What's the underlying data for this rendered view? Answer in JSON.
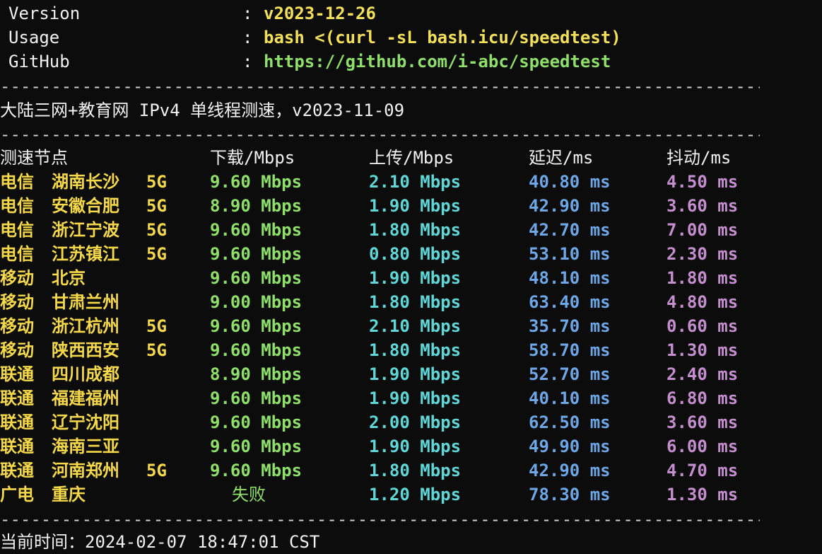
{
  "info": [
    {
      "key": "Version",
      "value": "v2023-12-26",
      "color": "yellow"
    },
    {
      "key": "Usage",
      "value": "bash <(curl -sL bash.icu/speedtest)",
      "color": "yellow"
    },
    {
      "key": "GitHub",
      "value": "https://github.com/i-abc/speedtest",
      "color": "green"
    }
  ],
  "separator": "----------------------------------------------------------------------------------------------------",
  "test_title": "大陆三网+教育网 IPv4 单线程测速，v2023-11-09",
  "headers": {
    "node": "测速节点",
    "download": "下载/Mbps",
    "upload": "上传/Mbps",
    "latency": "延迟/ms",
    "jitter": "抖动/ms"
  },
  "rows": [
    {
      "isp": "电信",
      "city": "湖南长沙",
      "tag": "5G",
      "download": "9.60 Mbps",
      "upload": "2.10 Mbps",
      "latency": "40.80 ms",
      "jitter": "4.50 ms"
    },
    {
      "isp": "电信",
      "city": "安徽合肥",
      "tag": "5G",
      "download": "8.90 Mbps",
      "upload": "1.90 Mbps",
      "latency": "42.90 ms",
      "jitter": "3.60 ms"
    },
    {
      "isp": "电信",
      "city": "浙江宁波",
      "tag": "5G",
      "download": "9.60 Mbps",
      "upload": "1.80 Mbps",
      "latency": "42.70 ms",
      "jitter": "7.00 ms"
    },
    {
      "isp": "电信",
      "city": "江苏镇江",
      "tag": "5G",
      "download": "9.60 Mbps",
      "upload": "0.80 Mbps",
      "latency": "53.10 ms",
      "jitter": "2.30 ms"
    },
    {
      "isp": "移动",
      "city": "北京",
      "tag": "",
      "download": "9.60 Mbps",
      "upload": "1.90 Mbps",
      "latency": "48.10 ms",
      "jitter": "1.80 ms"
    },
    {
      "isp": "移动",
      "city": "甘肃兰州",
      "tag": "",
      "download": "9.00 Mbps",
      "upload": "1.80 Mbps",
      "latency": "63.40 ms",
      "jitter": "4.80 ms"
    },
    {
      "isp": "移动",
      "city": "浙江杭州",
      "tag": "5G",
      "download": "9.60 Mbps",
      "upload": "2.10 Mbps",
      "latency": "35.70 ms",
      "jitter": "0.60 ms"
    },
    {
      "isp": "移动",
      "city": "陕西西安",
      "tag": "5G",
      "download": "9.60 Mbps",
      "upload": "1.80 Mbps",
      "latency": "58.70 ms",
      "jitter": "1.30 ms"
    },
    {
      "isp": "联通",
      "city": "四川成都",
      "tag": "",
      "download": "8.90 Mbps",
      "upload": "1.90 Mbps",
      "latency": "52.70 ms",
      "jitter": "2.40 ms"
    },
    {
      "isp": "联通",
      "city": "福建福州",
      "tag": "",
      "download": "9.60 Mbps",
      "upload": "1.90 Mbps",
      "latency": "40.10 ms",
      "jitter": "6.80 ms"
    },
    {
      "isp": "联通",
      "city": "辽宁沈阳",
      "tag": "",
      "download": "9.60 Mbps",
      "upload": "2.00 Mbps",
      "latency": "62.50 ms",
      "jitter": "3.60 ms"
    },
    {
      "isp": "联通",
      "city": "海南三亚",
      "tag": "",
      "download": "9.60 Mbps",
      "upload": "1.90 Mbps",
      "latency": "49.90 ms",
      "jitter": "6.00 ms"
    },
    {
      "isp": "联通",
      "city": "河南郑州",
      "tag": "5G",
      "download": "9.60 Mbps",
      "upload": "1.80 Mbps",
      "latency": "42.90 ms",
      "jitter": "4.70 ms"
    },
    {
      "isp": "广电",
      "city": "重庆",
      "tag": "",
      "download": "失败",
      "download_failed": true,
      "upload": "1.20 Mbps",
      "latency": "78.30 ms",
      "jitter": "1.30 ms"
    }
  ],
  "footer": "当前时间：2024-02-07 18:47:01 CST"
}
